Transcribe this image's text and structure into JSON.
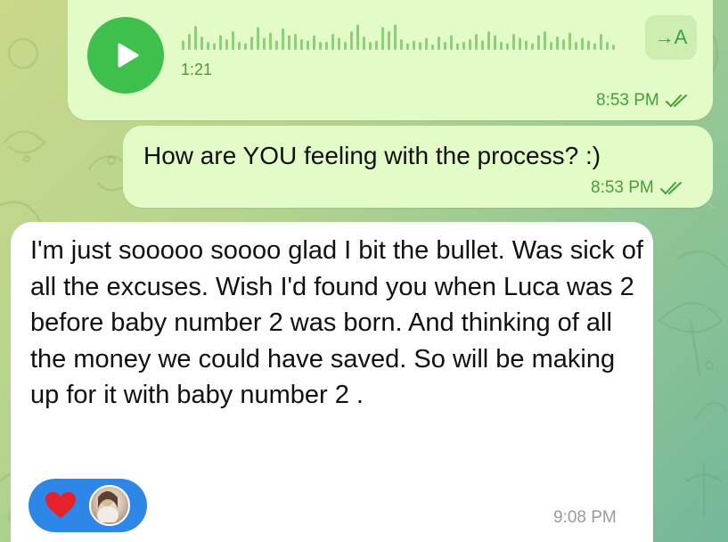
{
  "voice_message": {
    "duration": "1:21",
    "transcribe_label": "→A",
    "time": "8:53 PM",
    "waveform_levels": [
      0.35,
      0.6,
      0.9,
      0.5,
      0.3,
      0.25,
      0.55,
      0.4,
      0.7,
      0.3,
      0.25,
      0.5,
      0.85,
      0.45,
      0.65,
      0.35,
      0.8,
      0.55,
      0.6,
      0.4,
      0.35,
      0.55,
      0.3,
      0.3,
      0.6,
      0.45,
      0.3,
      0.7,
      0.95,
      0.5,
      0.3,
      0.35,
      0.85,
      0.7,
      0.95,
      0.4,
      0.25,
      0.35,
      0.3,
      0.45,
      0.2,
      0.5,
      0.3,
      0.55,
      0.25,
      0.3,
      0.4,
      0.6,
      0.35,
      0.7,
      0.55,
      0.3,
      0.25,
      0.6,
      0.45,
      0.35,
      0.25,
      0.55,
      0.7,
      0.3,
      0.5,
      0.4,
      0.65,
      0.3,
      0.45,
      0.35,
      0.25,
      0.6,
      0.3,
      0.2
    ],
    "status": "read"
  },
  "question_message": {
    "text": "How are YOU feeling with the process? :)",
    "time": "8:53 PM",
    "status": "read"
  },
  "reply_message": {
    "text": "I'm just sooooo soooo glad I bit the bullet. Was sick of all the excuses.   Wish I'd found you when Luca was 2 before baby number 2 was born. And thinking of all the money we could have saved.   So will be making up for it with baby number 2 .",
    "time": "9:08 PM",
    "reaction": {
      "emoji": "heart-icon",
      "color": "#e5212c"
    }
  },
  "colors": {
    "outgoing_bubble": "#e2fbc7",
    "incoming_bubble": "#ffffff",
    "accent_green": "#3fbf4c",
    "reaction_blue": "#2e86e6"
  }
}
